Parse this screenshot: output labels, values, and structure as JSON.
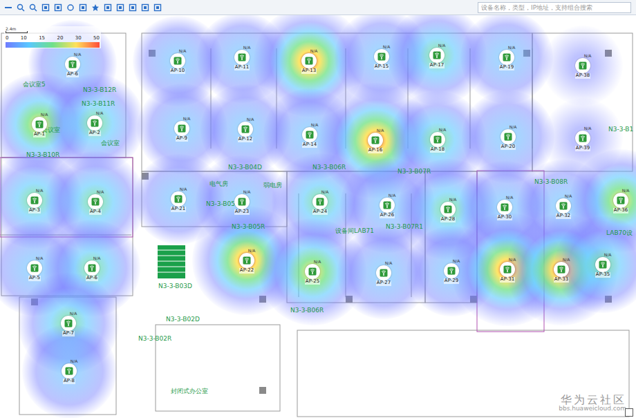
{
  "toolbar": {
    "search": {
      "placeholder": "设备名称，类型，IP地址，支持组合搜索"
    }
  },
  "legend": {
    "scale": "2.4m",
    "ticks": [
      "0",
      "10",
      "15",
      "20",
      "30",
      "50"
    ]
  },
  "rooms": [
    {
      "label": "会议室5"
    },
    {
      "label": "N3-3-B12R"
    },
    {
      "label": "N3-3-B11R"
    },
    {
      "label": "会议室"
    },
    {
      "label": "会议室"
    },
    {
      "label": "N3-3-B10R"
    },
    {
      "label": "N3-3-B04D"
    },
    {
      "label": "电气房"
    },
    {
      "label": "弱电房"
    },
    {
      "label": "N3-3-B06R"
    },
    {
      "label": "N3-3-B05R"
    },
    {
      "label": "N3-3-B05R"
    },
    {
      "label": "设备间LAB71"
    },
    {
      "label": "N3-3-B07R1"
    },
    {
      "label": "N3-3-B07R"
    },
    {
      "label": "N3-3-B08R"
    },
    {
      "label": "LAB70设"
    },
    {
      "label": "N3-3-B03D"
    },
    {
      "label": "N3-3-B02D"
    },
    {
      "label": "N3-3-B02R"
    },
    {
      "label": "封闭式办公室"
    },
    {
      "label": "N3-3-B1"
    },
    {
      "label": "N3-3-B06R"
    }
  ],
  "aps": [
    {
      "label": "AP-6",
      "status": "N/A",
      "level": 0.3
    },
    {
      "label": "AP-10",
      "status": "N/A",
      "level": 0.35
    },
    {
      "label": "AP-11",
      "status": "N/A",
      "level": 0.35
    },
    {
      "label": "AP-13",
      "status": "N/A",
      "level": 0.85
    },
    {
      "label": "AP-15",
      "status": "N/A",
      "level": 0.45
    },
    {
      "label": "AP-17",
      "status": "N/A",
      "level": 0.55
    },
    {
      "label": "AP-19",
      "status": "N/A",
      "level": 0.4
    },
    {
      "label": "AP-38",
      "status": "N/A",
      "level": 0.1
    },
    {
      "label": "AP-1",
      "status": "N/A",
      "level": 0.65
    },
    {
      "label": "AP-2",
      "status": "N/A",
      "level": 0.55
    },
    {
      "label": "AP-9",
      "status": "N/A",
      "level": 0.35
    },
    {
      "label": "AP-12",
      "status": "N/A",
      "level": 0.35
    },
    {
      "label": "AP-14",
      "status": "N/A",
      "level": 0.4
    },
    {
      "label": "AP-16",
      "status": "N/A",
      "level": 0.95
    },
    {
      "label": "AP-18",
      "status": "N/A",
      "level": 0.5
    },
    {
      "label": "AP-20",
      "status": "N/A",
      "level": 0.4
    },
    {
      "label": "AP-39",
      "status": "N/A",
      "level": 0.1
    },
    {
      "label": "AP-21",
      "status": "N/A",
      "level": 0.35
    },
    {
      "label": "AP-23",
      "status": "N/A",
      "level": 0.4
    },
    {
      "label": "AP-24",
      "status": "N/A",
      "level": 0.5
    },
    {
      "label": "AP-26",
      "status": "N/A",
      "level": 0.45
    },
    {
      "label": "AP-28",
      "status": "N/A",
      "level": 0.6
    },
    {
      "label": "AP-30",
      "status": "N/A",
      "level": 0.4
    },
    {
      "label": "AP-32",
      "status": "N/A",
      "level": 0.4
    },
    {
      "label": "AP-36",
      "status": "N/A",
      "level": 0.65
    },
    {
      "label": "AP-3",
      "status": "N/A",
      "level": 0.5
    },
    {
      "label": "AP-4",
      "status": "N/A",
      "level": 0.6
    },
    {
      "label": "AP-22",
      "status": "N/A",
      "level": 0.8
    },
    {
      "label": "AP-25",
      "status": "N/A",
      "level": 0.75
    },
    {
      "label": "AP-27",
      "status": "N/A",
      "level": 0.4
    },
    {
      "label": "AP-29",
      "status": "N/A",
      "level": 0.35
    },
    {
      "label": "AP-31",
      "status": "N/A",
      "level": 0.9
    },
    {
      "label": "AP-33",
      "status": "N/A",
      "level": 0.85
    },
    {
      "label": "AP-35",
      "status": "N/A",
      "level": 0.5
    },
    {
      "label": "AP-5",
      "status": "N/A",
      "level": 0.45
    },
    {
      "label": "AP-6",
      "status": "N/A",
      "level": 0.5
    },
    {
      "label": "AP-7",
      "status": "N/A",
      "level": 0.6
    },
    {
      "label": "AP-8",
      "status": "N/A",
      "level": 0.45
    }
  ],
  "watermark": {
    "title": "华为云社区",
    "url": "bbs.huaweicloud.com"
  }
}
